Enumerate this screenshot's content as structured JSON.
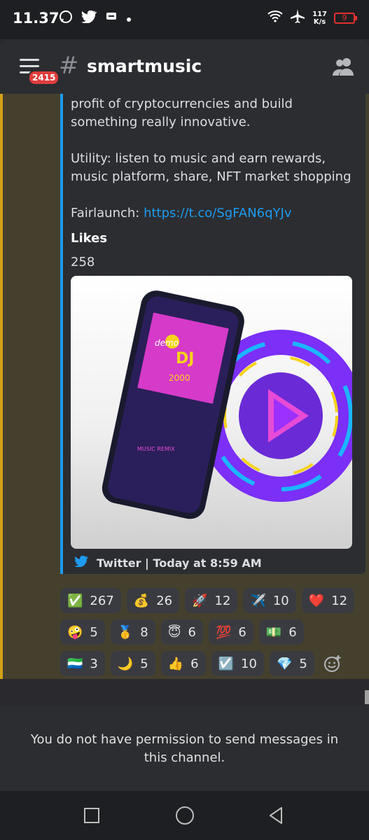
{
  "status_bar": {
    "time": "11.37",
    "net_speed_value": "117",
    "net_speed_unit": "K/s",
    "battery": "9"
  },
  "header": {
    "badge_count": "2415",
    "hash": "#",
    "channel_name": "smartmusic"
  },
  "message": {
    "lines": [
      "profit of cryptocurrencies and build something really innovative.",
      "Utility: listen to music and earn rewards, music platform, share, NFT market shopping"
    ],
    "fairlaunch_label": "Fairlaunch: ",
    "fairlaunch_link": "https://t.co/SgFAN6qYJv",
    "likes_title": "Likes",
    "likes_value": "258",
    "image_texts": {
      "demo": "demo",
      "dj": "DJ",
      "year": "2000",
      "remix": "MUSIC REMIX"
    },
    "footer": "Twitter | Today at 8:59 AM"
  },
  "reactions": [
    [
      {
        "emoji": "✅",
        "count": "267"
      },
      {
        "emoji": "💰",
        "count": "26"
      },
      {
        "emoji": "🚀",
        "count": "12"
      },
      {
        "emoji": "✈️",
        "count": "10"
      },
      {
        "emoji": "❤️",
        "count": "12"
      }
    ],
    [
      {
        "emoji": "🤪",
        "count": "5"
      },
      {
        "emoji": "🥇",
        "count": "8"
      },
      {
        "emoji": "😇",
        "count": "6"
      },
      {
        "emoji": "💯",
        "count": "6"
      },
      {
        "emoji": "💵",
        "count": "6"
      }
    ],
    [
      {
        "emoji": "🇸🇱",
        "count": "3"
      },
      {
        "emoji": "🌙",
        "count": "5"
      },
      {
        "emoji": "👍",
        "count": "6"
      },
      {
        "emoji": "☑️",
        "count": "10"
      },
      {
        "emoji": "💎",
        "count": "5"
      }
    ]
  ],
  "composer": {
    "notice": "You do not have permission to send messages in this channel."
  },
  "colors": {
    "link": "#1d9bf0",
    "highlight": "#d4a017",
    "badge": "#e03d3d"
  }
}
